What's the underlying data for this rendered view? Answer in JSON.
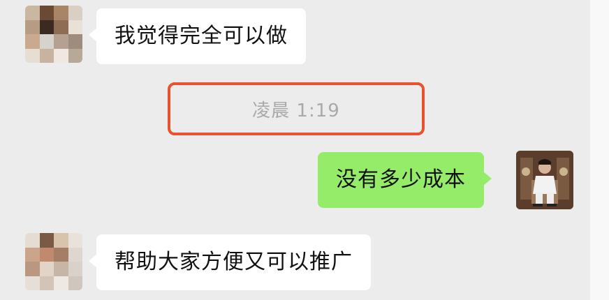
{
  "conversation": {
    "messages": [
      {
        "sender": "contact",
        "text": "我觉得完全可以做"
      },
      {
        "sender": "me",
        "text": "没有多少成本"
      },
      {
        "sender": "contact",
        "text": "帮助大家方便又可以推广"
      }
    ],
    "timestamp": "凌晨 1:19"
  },
  "colors": {
    "background": "#ececec",
    "incoming_bubble": "#ffffff",
    "outgoing_bubble": "#95ec69",
    "highlight_border": "#e8522f",
    "timestamp_text": "#a9a9a9"
  },
  "icons": {
    "contact_avatar": "pixelated-avatar-icon",
    "my_avatar": "person-photo-avatar-icon"
  }
}
